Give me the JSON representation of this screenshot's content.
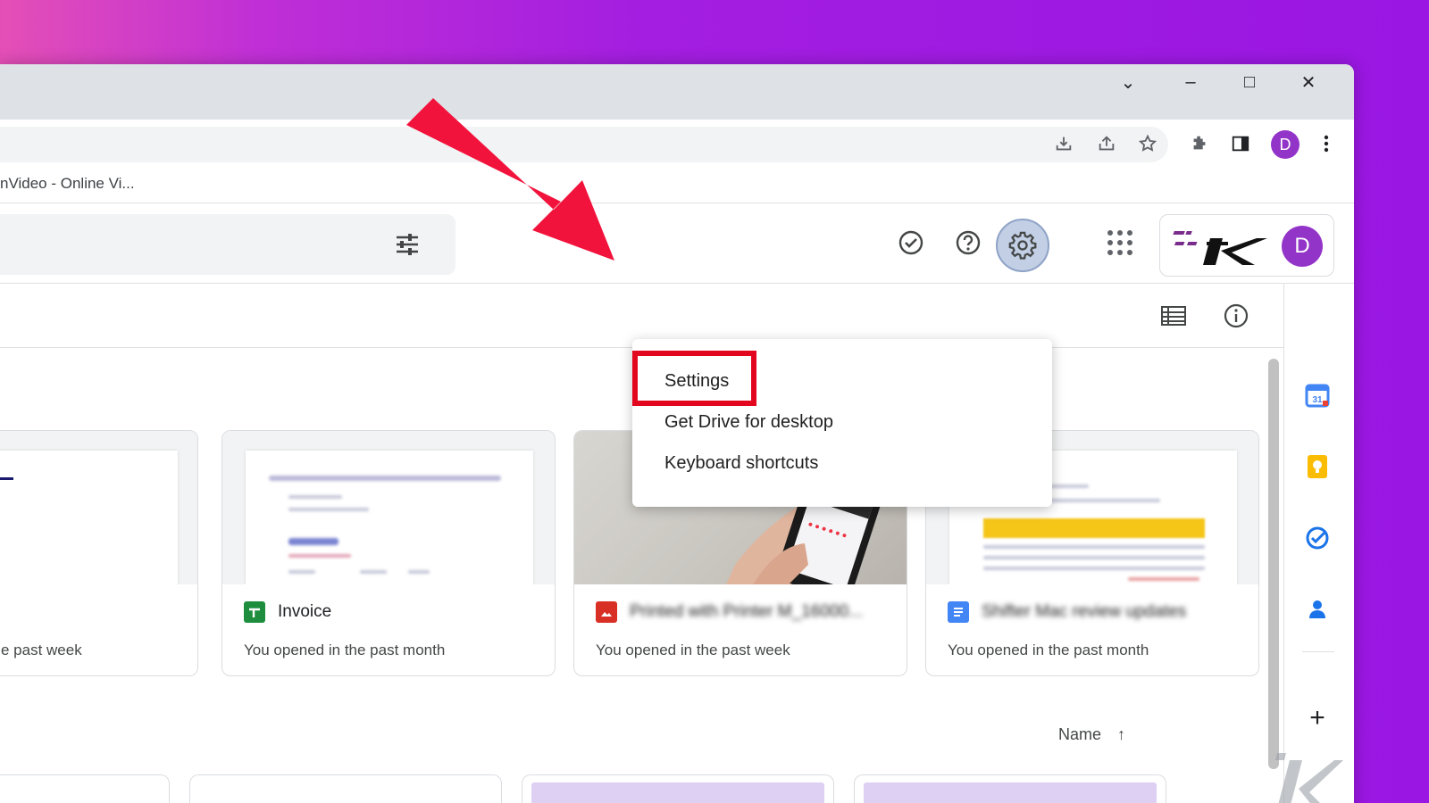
{
  "browser": {
    "controls": {
      "tab_search": "⌄",
      "minimize": "–",
      "maximize": "□",
      "close": "✕"
    },
    "toolbar": {
      "profile_initial": "D"
    },
    "bookmark_label": "nVideo - Online Vi..."
  },
  "drive_header": {
    "account_initial": "D"
  },
  "settings_menu": {
    "items": [
      "Settings",
      "Get Drive for desktop",
      "Keyboard shortcuts"
    ]
  },
  "suggested_files": [
    {
      "title": "",
      "meta": "e past week",
      "type": "document"
    },
    {
      "title": "Invoice",
      "meta": "You opened in the past month",
      "type": "sheets"
    },
    {
      "title": "Printed with Printer M_16000...",
      "meta": "You opened in the past week",
      "type": "image"
    },
    {
      "title": "Shifter Mac review updates",
      "meta": "You opened in the past month",
      "type": "docs"
    }
  ],
  "sort": {
    "label": "Name",
    "direction_icon": "↑"
  },
  "side_panel": {
    "add_label": "+"
  },
  "colors": {
    "highlight": "#e2061e",
    "arrow": "#f2133c",
    "avatar": "#9334c9",
    "background_gradient_start": "#e44fb6",
    "background_gradient_end": "#9a17e3"
  }
}
